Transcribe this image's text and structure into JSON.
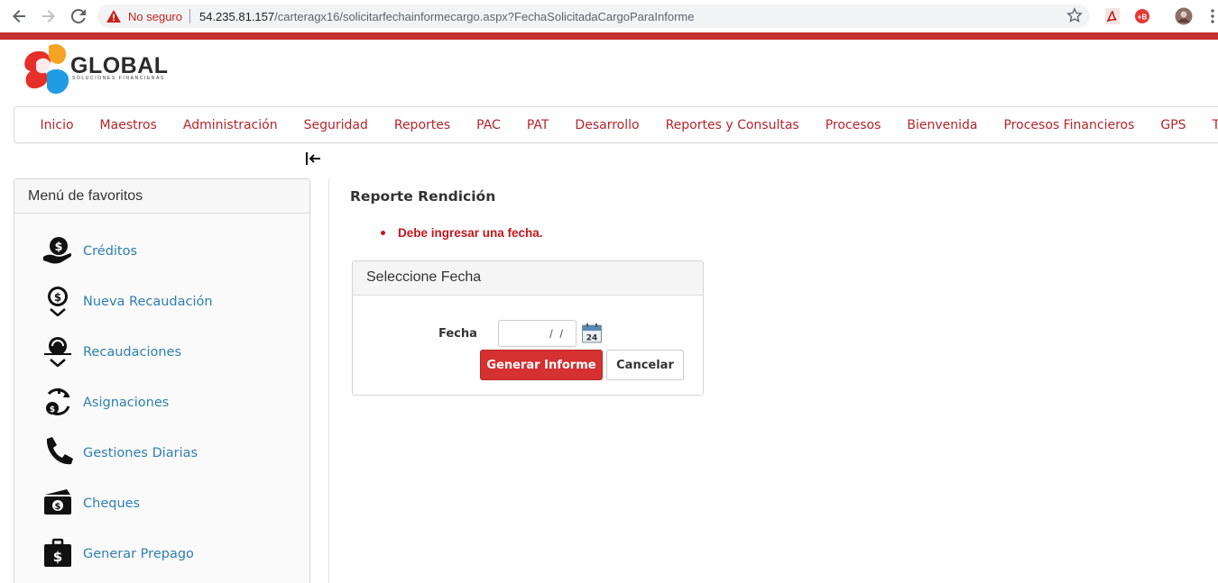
{
  "browser": {
    "security_label": "No seguro",
    "url_host": "54.235.81.157",
    "url_path": "/carteragx16/solicitarfechainformecargo.aspx?FechaSolicitadaCargoParaInforme"
  },
  "brand": {
    "name": "GLOBAL",
    "tagline": "Soluciones Financieras",
    "accent_color": "#c6302f"
  },
  "topnav": {
    "items": [
      "Inicio",
      "Maestros",
      "Administración",
      "Seguridad",
      "Reportes",
      "PAC",
      "PAT",
      "Desarrollo",
      "Reportes y Consultas",
      "Procesos",
      "Bienvenida",
      "Procesos Financieros",
      "GPS",
      "TMC"
    ]
  },
  "favorites": {
    "title": "Menú de favoritos",
    "items": [
      {
        "label": "Créditos",
        "icon": "hand-dollar-icon"
      },
      {
        "label": "Nueva Recaudación",
        "icon": "dollar-download-icon"
      },
      {
        "label": "Recaudaciones",
        "icon": "hand-coin-download-icon"
      },
      {
        "label": "Asignaciones",
        "icon": "cycle-dollar-icon"
      },
      {
        "label": "Gestiones Diarias",
        "icon": "phone-icon"
      },
      {
        "label": "Cheques",
        "icon": "banknotes-icon"
      },
      {
        "label": "Generar Prepago",
        "icon": "briefcase-dollar-icon"
      }
    ]
  },
  "main": {
    "title": "Reporte Rendición",
    "error": "Debe ingresar una fecha.",
    "panel_title": "Seleccione Fecha",
    "date_label": "Fecha",
    "date_value": "/ /",
    "calendar_day": "24",
    "submit_label": "Generar Informe",
    "cancel_label": "Cancelar"
  }
}
